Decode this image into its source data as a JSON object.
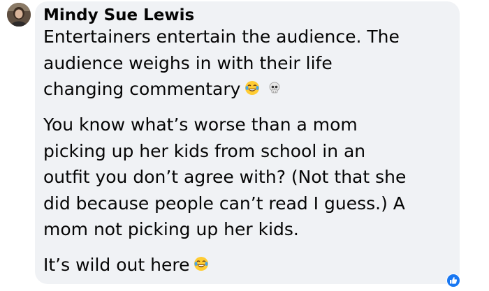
{
  "comment": {
    "author": "Mindy Sue Lewis",
    "paragraphs": [
      {
        "lines": [
          "Entertainers entertain the audience. The",
          "audience weighs in with their life",
          "changing commentary"
        ],
        "emojis": [
          "laughing-tears-emoji",
          "skull-emoji"
        ]
      },
      {
        "lines": [
          "You know what’s worse than a mom",
          "picking up her kids from school in an",
          "outfit you don’t agree with? (Not that she",
          "did because people can’t read I guess.) A",
          "mom not picking up her kids."
        ],
        "emojis": []
      },
      {
        "lines": [
          "It’s wild out here"
        ],
        "emojis": [
          "laughing-tears-emoji"
        ]
      }
    ]
  },
  "icons": {
    "avatar": "profile-photo",
    "reaction": "like-icon"
  },
  "colors": {
    "bubble": "#f0f2f5",
    "text": "#050505",
    "like_blue": "#1877f2",
    "emoji_yellow": "#ffcc33"
  }
}
